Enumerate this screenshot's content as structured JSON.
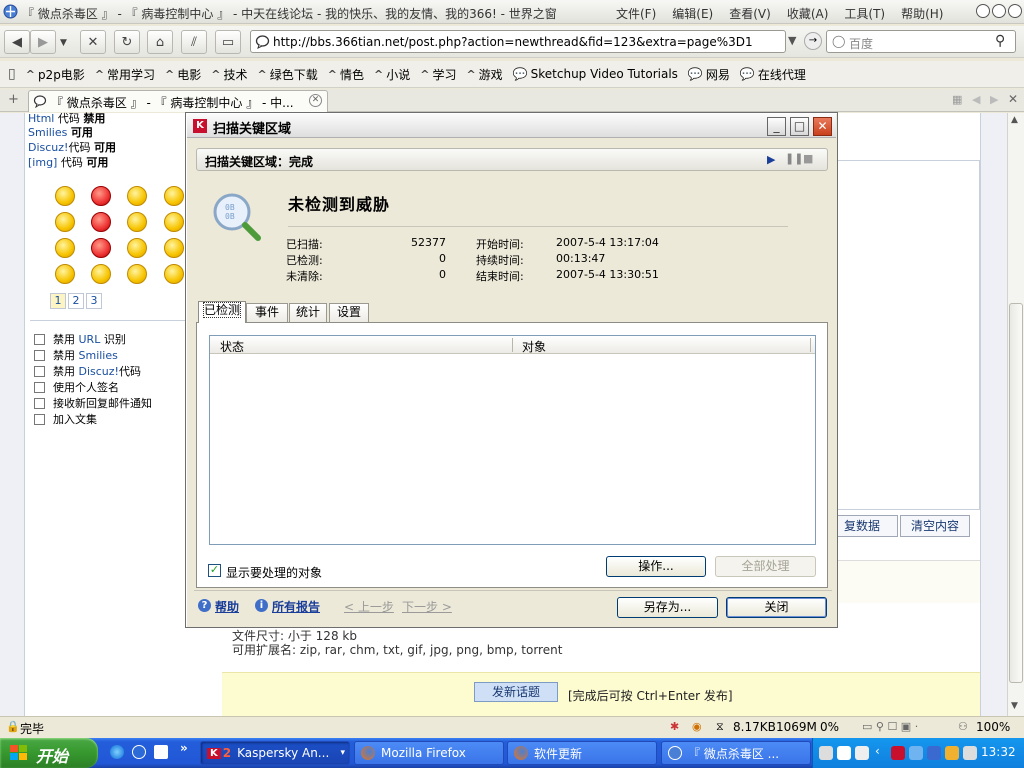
{
  "browser": {
    "title": "『 微点杀毒区 』 - 『 病毒控制中心 』 - 中天在线论坛 - 我的快乐、我的友情、我的366! - 世界之窗",
    "menu": [
      "文件(F)",
      "编辑(E)",
      "查看(V)",
      "收藏(A)",
      "工具(T)",
      "帮助(H)"
    ],
    "url": "http://bbs.366tian.net/post.php?action=newthread&fid=123&extra=page%3D1",
    "search_placeholder": "百度",
    "bookmarks": [
      "p2p电影",
      "常用学习",
      "电影",
      "技术",
      "绿色下载",
      "情色",
      "小说",
      "学习",
      "游戏",
      "Sketchup Video Tutorials",
      "网易",
      "在线代理"
    ],
    "tab_label": "『 微点杀毒区 』 - 『 病毒控制中心 』 - 中...",
    "status_left": "完毕",
    "status_right": {
      "speed": "8.17KB",
      "mem": "1069M",
      "cpu": "0%",
      "zoom": "100%"
    }
  },
  "forum": {
    "codes": [
      {
        "name": "Html",
        "suffix": " 代码",
        "state": "禁用"
      },
      {
        "name": "Smilies",
        "suffix": "",
        "state": "可用"
      },
      {
        "name": "Discuz!",
        "suffix": "代码",
        "state": "可用"
      },
      {
        "name": "[img]",
        "suffix": " 代码",
        "state": "可用"
      }
    ],
    "smiley_pages": [
      "1",
      "2",
      "3"
    ],
    "options": [
      {
        "prefix": "禁用 ",
        "name": "URL",
        "suffix": " 识别"
      },
      {
        "prefix": "禁用 ",
        "name": "Smilies",
        "suffix": ""
      },
      {
        "prefix": "禁用 ",
        "name": "Discuz!",
        "suffix": "代码"
      },
      {
        "prefix": "使用个人签名",
        "name": "",
        "suffix": ""
      },
      {
        "prefix": "接收新回复邮件通知",
        "name": "",
        "suffix": ""
      },
      {
        "prefix": "加入文集",
        "name": "",
        "suffix": ""
      }
    ],
    "restore_btn": "复数据",
    "clear_btn": "清空内容",
    "file_size": "文件尺寸: 小于 128 kb",
    "extensions": "可用扩展名: zip, rar, chm, txt, gif, jpg, png, bmp, torrent",
    "submit_btn": "发新话题",
    "submit_hint": "[完成后可按 Ctrl+Enter 发布]"
  },
  "kaspersky": {
    "window_title": "扫描关键区域",
    "status_bar": "扫描关键区域：完成",
    "headline": "未检测到威胁",
    "stats": [
      {
        "label": "已扫描:",
        "value": "52377"
      },
      {
        "label": "已检测:",
        "value": "0"
      },
      {
        "label": "未清除:",
        "value": "0"
      }
    ],
    "times": [
      {
        "label": "开始时间:",
        "value": "2007-5-4 13:17:04"
      },
      {
        "label": "持续时间:",
        "value": "00:13:47"
      },
      {
        "label": "结束时间:",
        "value": "2007-5-4 13:30:51"
      }
    ],
    "tabs": [
      "已检测",
      "事件",
      "统计",
      "设置"
    ],
    "columns": [
      "状态",
      "对象"
    ],
    "show_label": "显示要处理的对象",
    "action_btn": "操作...",
    "process_all_btn": "全部处理",
    "help": "帮助",
    "all_reports": "所有报告",
    "prev": "< 上一步",
    "next": "下一步 >",
    "save_as": "另存为...",
    "close": "关闭"
  },
  "taskbar": {
    "start": "开始",
    "items": [
      {
        "label": "Kaspersky An...",
        "badge": "2"
      },
      {
        "label": "Mozilla Firefox",
        "badge": ""
      },
      {
        "label": "软件更新",
        "badge": ""
      },
      {
        "label": "『 微点杀毒区 ...",
        "badge": ""
      }
    ],
    "clock": "13:32"
  },
  "colors": {
    "accent": "#245edb",
    "kaspersky_red": "#c9401c",
    "link": "#1a4fa0"
  }
}
